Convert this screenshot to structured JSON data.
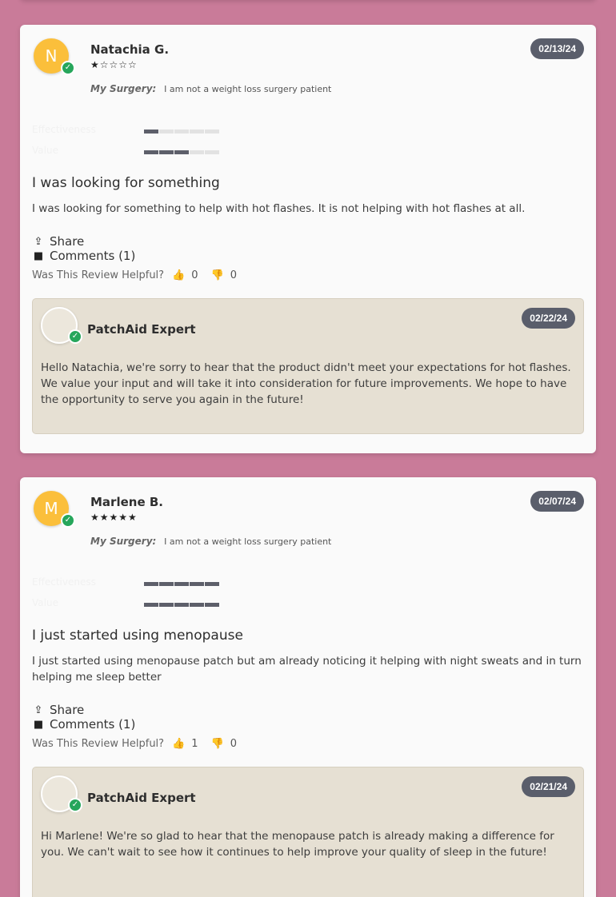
{
  "reviews": [
    {
      "avatar_initial": "N",
      "name": "Natachia G.",
      "stars_text": "★☆☆☆☆",
      "rating": 1,
      "date": "02/13/24",
      "surgery_label": "My Surgery:",
      "surgery_value": "I am not a weight loss surgery patient",
      "effectiveness_label": "Effectiveness",
      "effectiveness_value": 1,
      "value_label": "Value",
      "value_value": 3,
      "title": "I was looking for something",
      "body": "I was looking for something to help with hot flashes. It is not helping with hot flashes at all.",
      "share_label": "Share",
      "comments_label": "Comments (1)",
      "helpful_label": "Was This Review Helpful?",
      "helpful_up": "0",
      "helpful_down": "0",
      "reply": {
        "name": "PatchAid Expert",
        "date": "02/22/24",
        "text": "Hello Natachia, we're sorry to hear that the product didn't meet your expectations for hot flashes. We value your input and will take it into consideration for future improvements. We hope to have the opportunity to serve you again in the future!"
      }
    },
    {
      "avatar_initial": "M",
      "name": "Marlene B.",
      "stars_text": "★★★★★",
      "rating": 5,
      "date": "02/07/24",
      "surgery_label": "My Surgery:",
      "surgery_value": "I am not a weight loss surgery patient",
      "effectiveness_label": "Effectiveness",
      "effectiveness_value": 5,
      "value_label": "Value",
      "value_value": 5,
      "title": "I just started using menopause",
      "body": "I just started using menopause patch but am already noticing it helping with night sweats and in turn helping me sleep better",
      "share_label": "Share",
      "comments_label": "Comments (1)",
      "helpful_label": "Was This Review Helpful?",
      "helpful_up": "1",
      "helpful_down": "0",
      "reply": {
        "name": "PatchAid Expert",
        "date": "02/21/24",
        "text": "Hi Marlene! We're so glad to hear that the menopause patch is already making a difference for you. We can't wait to see how it continues to help improve your quality of sleep in the future!"
      }
    }
  ],
  "icons": {
    "share": "share-icon",
    "comments": "comment-icon",
    "thumbs_up": "thumbs-up-icon",
    "thumbs_down": "thumbs-down-icon",
    "verified": "check-icon"
  },
  "colors": {
    "page_background": "#c97b99",
    "card_background": "#fafafa",
    "date_badge": "#5a5e6b",
    "avatar": "#fbbf3b",
    "verified": "#26a65b",
    "expert_box": "#e6e0d3"
  }
}
